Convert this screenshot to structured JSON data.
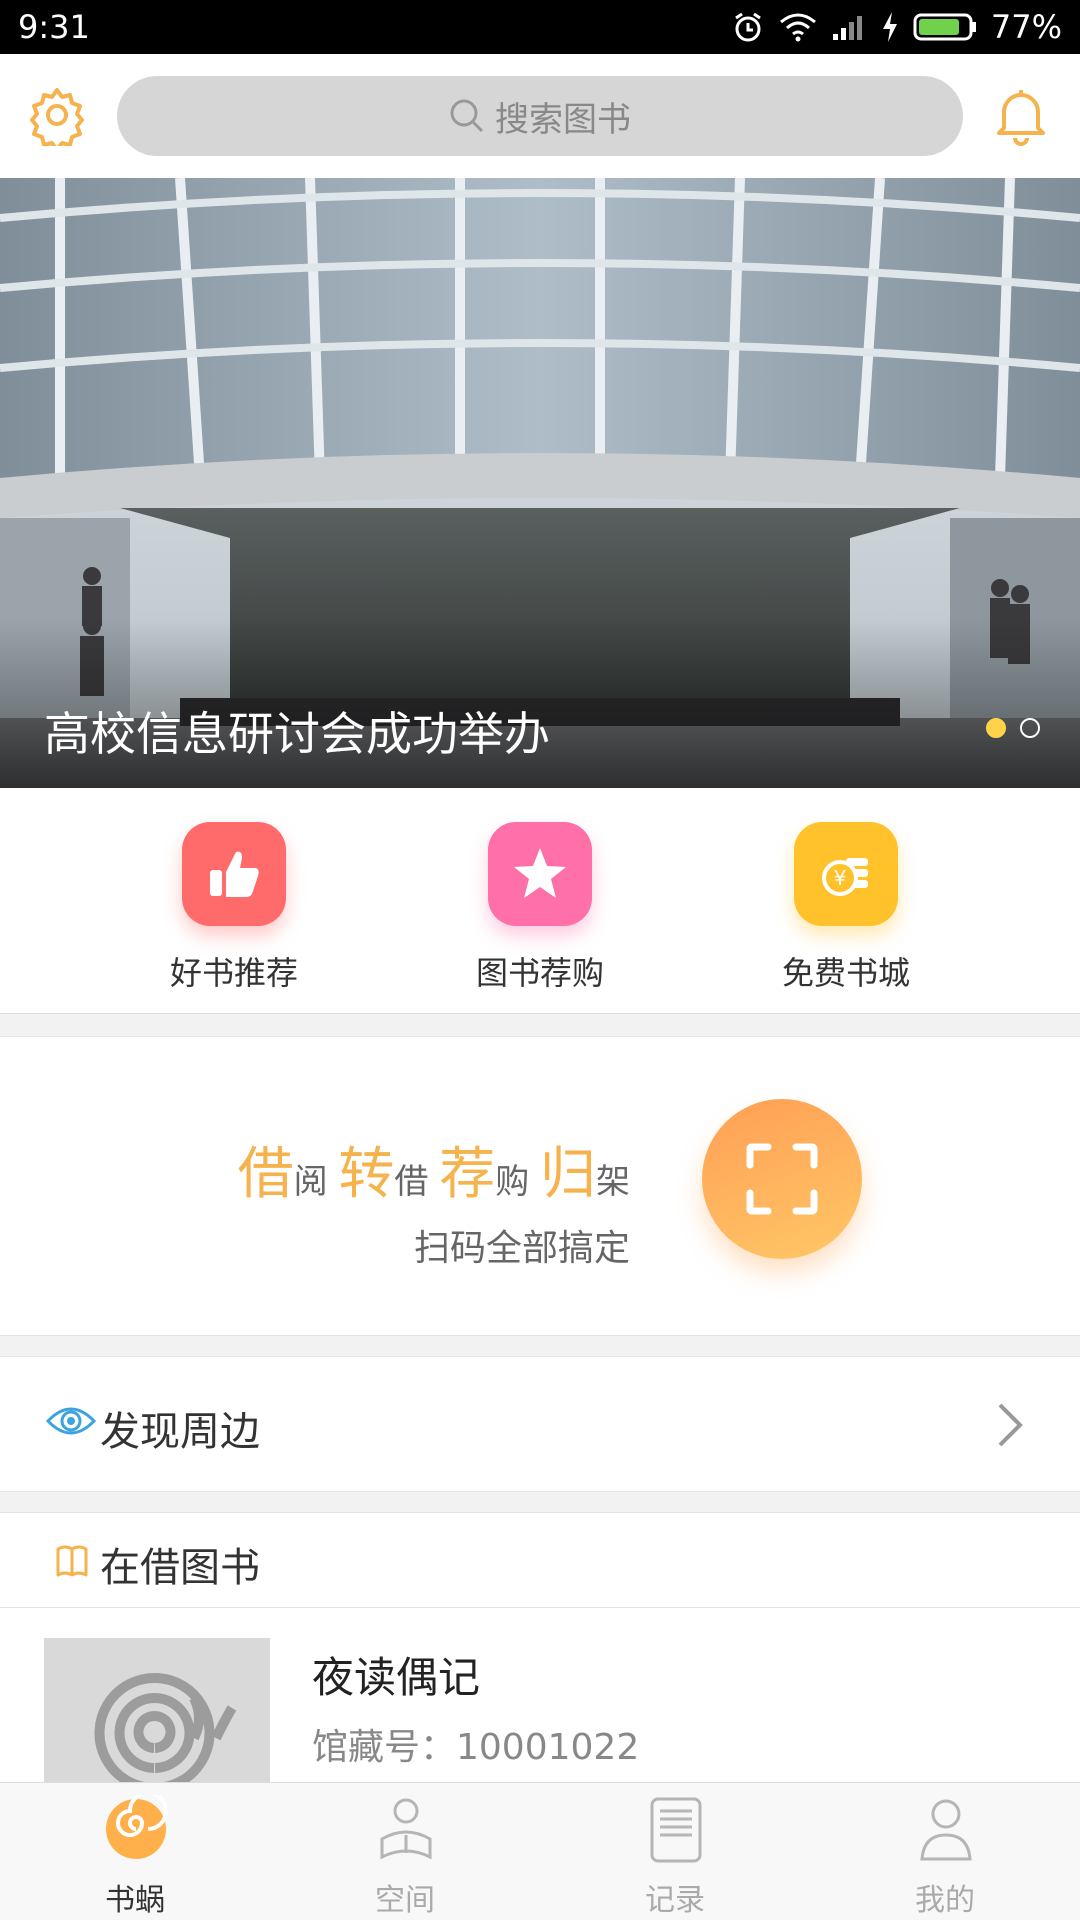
{
  "status_bar": {
    "time": "9:31",
    "battery": "77%"
  },
  "header": {
    "search_placeholder": "搜索图书"
  },
  "banner": {
    "caption": "高校信息研讨会成功举办",
    "page_count": 2,
    "active_index": 0
  },
  "quick_actions": [
    {
      "label": "好书推荐",
      "icon": "thumbs-up-icon",
      "color": "#ff6b6b"
    },
    {
      "label": "图书荐购",
      "icon": "star-icon",
      "color": "#ff6fa8"
    },
    {
      "label": "免费书城",
      "icon": "coin-icon",
      "color": "#ffc22a"
    }
  ],
  "scan_card": {
    "words": [
      {
        "big": "借",
        "small": "阅"
      },
      {
        "big": "转",
        "small": "借"
      },
      {
        "big": "荐",
        "small": "购"
      },
      {
        "big": "归",
        "small": "架"
      }
    ],
    "subtitle": "扫码全部搞定"
  },
  "discover": {
    "label": "发现周边"
  },
  "borrowed": {
    "label": "在借图书",
    "books": [
      {
        "title": "夜读偶记",
        "call_number": "馆藏号：10001022"
      }
    ]
  },
  "tabbar": [
    {
      "label": "书蜗",
      "icon": "snail-icon",
      "active": true
    },
    {
      "label": "空间",
      "icon": "reader-icon",
      "active": false
    },
    {
      "label": "记录",
      "icon": "record-icon",
      "active": false
    },
    {
      "label": "我的",
      "icon": "person-icon",
      "active": false
    }
  ],
  "colors": {
    "accent": "#f5b24d",
    "scan_gradient_start": "#ff9f55",
    "scan_gradient_end": "#ffc766"
  }
}
